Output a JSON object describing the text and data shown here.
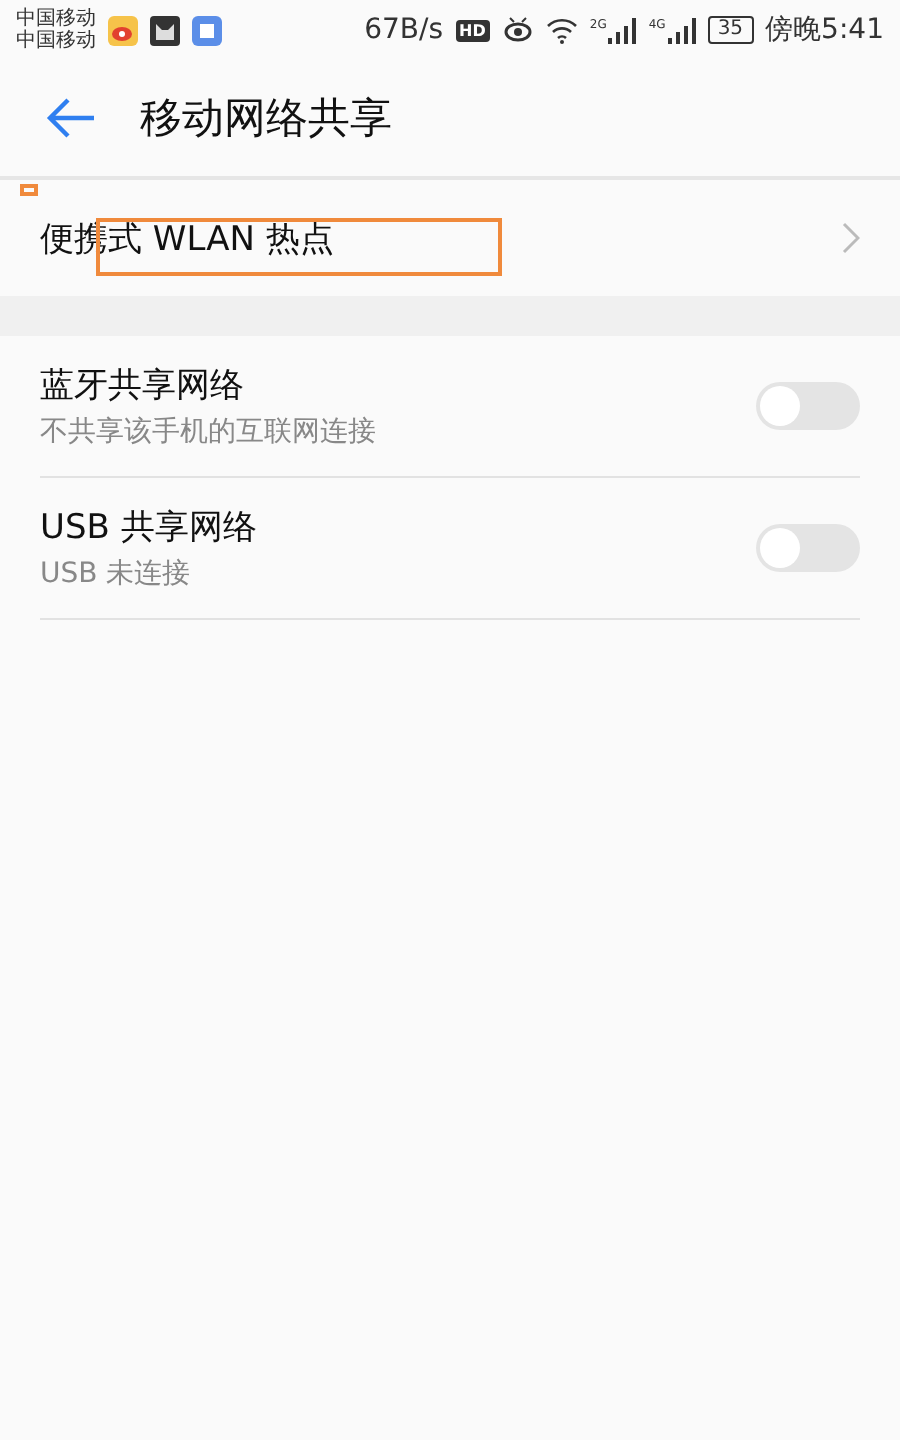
{
  "status_bar": {
    "carriers": [
      "中国移动",
      "中国移动"
    ],
    "speed": "67B/s",
    "hd": "HD",
    "signals": [
      "2G",
      "4G"
    ],
    "battery": "35",
    "time": "傍晚5:41"
  },
  "header": {
    "title": "移动网络共享"
  },
  "sections": [
    {
      "items": [
        {
          "kind": "link",
          "title": "便携式 WLAN 热点",
          "highlighted": true
        }
      ]
    },
    {
      "items": [
        {
          "kind": "toggle",
          "title": "蓝牙共享网络",
          "subtitle": "不共享该手机的互联网连接",
          "on": false
        },
        {
          "kind": "toggle",
          "title": "USB 共享网络",
          "subtitle": "USB 未连接",
          "on": false
        }
      ]
    }
  ]
}
